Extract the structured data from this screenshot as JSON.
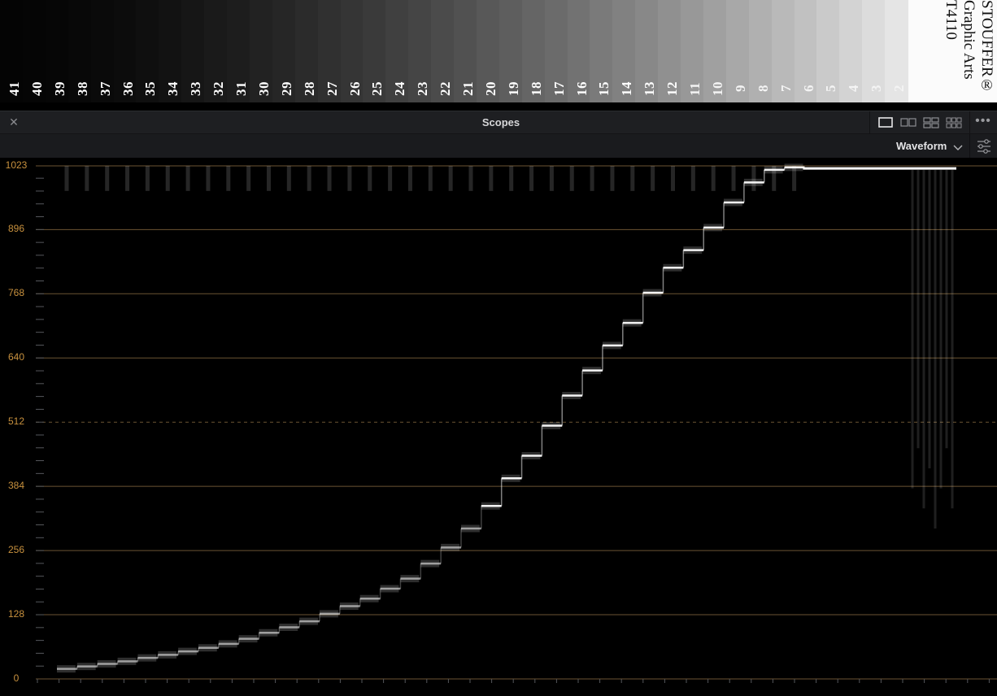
{
  "grayscale_strip": {
    "step_labels": [
      "41",
      "40",
      "39",
      "38",
      "37",
      "36",
      "35",
      "34",
      "33",
      "32",
      "31",
      "30",
      "29",
      "28",
      "27",
      "26",
      "25",
      "24",
      "23",
      "22",
      "21",
      "20",
      "19",
      "18",
      "17",
      "16",
      "15",
      "14",
      "13",
      "12",
      "11",
      "10",
      "9",
      "8",
      "7",
      "6",
      "5",
      "4",
      "3",
      "2"
    ],
    "brand_lines": [
      "STOUFFER®",
      "Graphic Arts",
      "T4110"
    ]
  },
  "panel": {
    "title": "Scopes",
    "close_icon": "close-icon",
    "layout_options": [
      "single-view-icon",
      "two-up-view-icon",
      "quad-view-icon",
      "six-up-view-icon"
    ],
    "selected_layout": "single-view-icon",
    "menu_icon": "more-horizontal-icon"
  },
  "toolbar": {
    "scope_type": "Waveform",
    "dropdown_icon": "chevron-down-icon",
    "settings_icon": "sliders-icon"
  },
  "waveform": {
    "axis_labels": [
      "1023",
      "896",
      "768",
      "640",
      "512",
      "384",
      "256",
      "128",
      "0"
    ],
    "axis_max": 1023,
    "midline_value": 512,
    "colors": {
      "grid": "#6b5433",
      "labels": "#c8913e",
      "trace": "#ffffff",
      "background": "#000000"
    },
    "steps_levels": [
      20,
      25,
      30,
      35,
      42,
      48,
      55,
      62,
      70,
      80,
      92,
      103,
      115,
      130,
      145,
      160,
      180,
      200,
      230,
      262,
      300,
      345,
      400,
      445,
      505,
      565,
      615,
      665,
      710,
      770,
      820,
      855,
      900,
      950,
      990,
      1015,
      1020
    ]
  }
}
